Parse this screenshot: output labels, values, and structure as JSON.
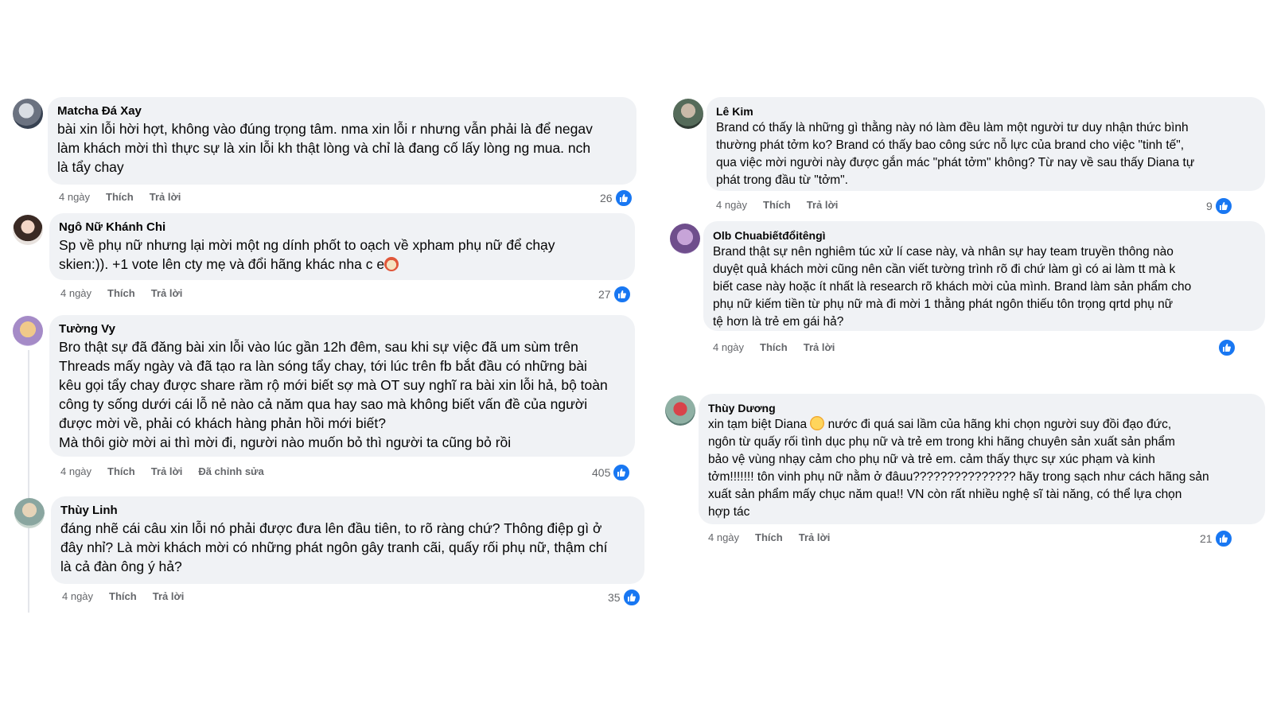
{
  "left": [
    {
      "author": "Matcha Đá Xay",
      "text": "bài xin lỗi hời hợt, không vào đúng trọng tâm. nma xin lỗi r nhưng vẫn phải là để negav\nlàm khách mời thì thực sự là xin lỗi kh thật lòng và chỉ là đang cố lấy lòng ng mua. nch\nlà tẩy chay",
      "age": "4 ngày",
      "like": "Thích",
      "reply": "Trả lời",
      "count": "26"
    },
    {
      "author": "Ngô Nữ Khánh Chi",
      "text": "Sp về phụ nữ nhưng lại mời một ng dính phốt to oạch về xpham phụ nữ để chạy\nskien:)). +1 vote lên cty mẹ và đổi hãng khác nha c e",
      "age": "4 ngày",
      "like": "Thích",
      "reply": "Trả lời",
      "count": "27"
    },
    {
      "author": "Tường Vy",
      "text": "Bro thật sự đã đăng bài xin lỗi vào lúc gần 12h đêm, sau khi sự việc đã um sùm trên\nThreads mấy ngày và đã tạo ra làn sóng tẩy chay, tới lúc trên fb bắt đầu có những bài\nkêu gọi tẩy chay được share rầm rộ mới biết sợ mà OT suy nghĩ ra bài xin lỗi hả, bộ toàn\ncông ty sống dưới cái lỗ nẻ nào cả năm qua hay sao mà không biết vấn đề của người\nđược mời về, phải có khách hàng phản hồi mới biết?\nMà thôi giờ mời ai thì mời đi, người nào muốn bỏ thì người ta cũng bỏ rồi",
      "age": "4 ngày",
      "like": "Thích",
      "reply": "Trả lời",
      "edited": "Đã chỉnh sửa",
      "count": "405"
    },
    {
      "author": "Thùy Linh",
      "text": "đáng nhẽ cái câu xin lỗi nó phải được đưa lên đầu tiên, to rõ ràng chứ? Thông điệp gì ở\nđây nhỉ? Là mời khách mời có những phát ngôn gây tranh cãi, quấy rối phụ nữ, thậm chí\nlà cả đàn ông ý hả?",
      "age": "4 ngày",
      "like": "Thích",
      "reply": "Trả lời",
      "count": "35"
    }
  ],
  "right": [
    {
      "author": "Lê Kim",
      "text": "Brand có thấy là những gì thằng này nó làm đều làm một người tư duy nhận thức bình\nthường phát tởm ko? Brand có thấy bao công sức nỗ lực của brand cho việc \"tinh tế\",\nqua việc mời người này được gắn mác \"phát tởm\" không? Từ nay về sau thấy Diana tự\nphát trong đầu từ \"tởm\".",
      "age": "4 ngày",
      "like": "Thích",
      "reply": "Trả lời",
      "count": "9"
    },
    {
      "author": "Olb Chuabiếtđổitêngì",
      "text": "Brand thật sự nên nghiêm túc xử lí case này, và nhân sự hay team truyền thông nào\nduyệt quả khách mời cũng nên cần viết tường trình rõ đi chứ làm gì có ai làm tt mà k\nbiết case này hoặc ít nhất là research rõ khách mời của mình. Brand làm sản phẩm cho\nphụ nữ kiếm tiền từ phụ nữ mà đi mời 1 thằng phát ngôn thiếu tôn trọng qrtd phụ nữ\ntệ hơn là trẻ em gái hả?",
      "age": "4 ngày",
      "like": "Thích",
      "reply": "Trả lời",
      "count": ""
    },
    {
      "author": "Thùy Dương",
      "text_a": "xin tạm biệt Diana",
      "text_b": " nước đi quá sai lầm của hãng khi chọn người suy đồi đạo đức,\nngôn từ quấy rối tình dục phụ nữ và trẻ em trong khi hãng chuyên sản xuất sản phẩm\nbảo vệ vùng nhạy cảm cho phụ nữ và trẻ em. cảm thấy thực sự xúc phạm và kinh\ntởm!!!!!!! tôn vinh phụ nữ nằm ở đâuu??????????????? hãy trong sạch như cách hãng sản\nxuất sản phẩm mấy chục năm qua!! VN còn rất nhiều nghệ sĩ tài năng, có thể lựa chọn\nhợp tác",
      "age": "4 ngày",
      "like": "Thích",
      "reply": "Trả lời",
      "count": "21"
    }
  ],
  "icons": {
    "like": "like-thumb-icon",
    "emoji_face": "smiling-face-icon",
    "emoji_clown": "clown-face-icon"
  },
  "colors": {
    "bubble": "#f0f2f5",
    "meta": "#65676b",
    "like_blue": "#1877f2"
  }
}
